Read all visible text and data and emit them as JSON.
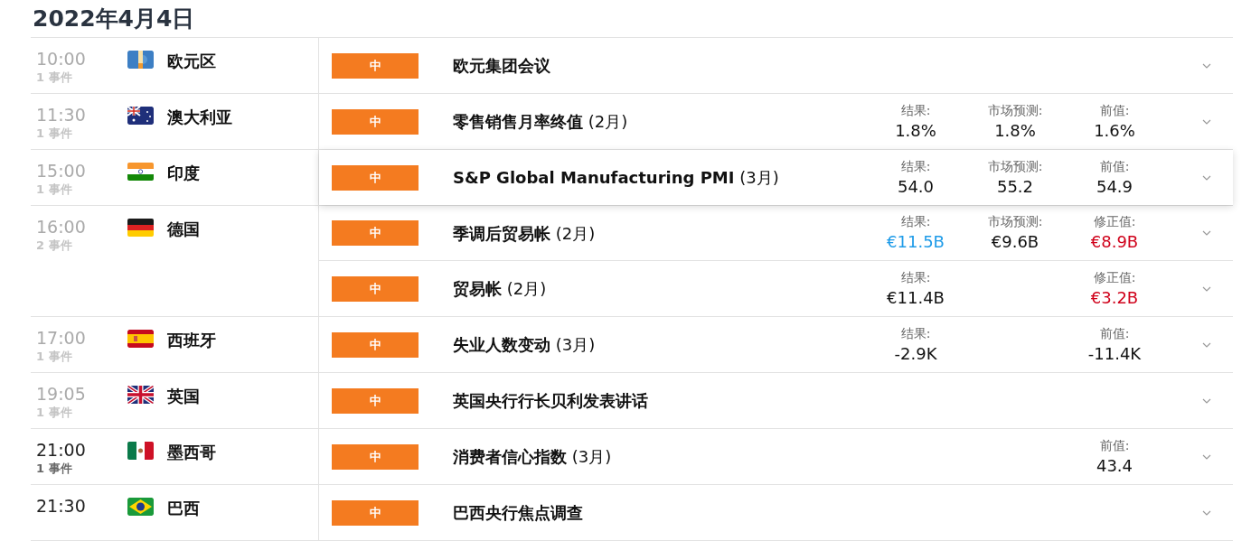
{
  "date_heading": "2022年4月4日",
  "groups": [
    {
      "time": "10:00",
      "count": "1 事件",
      "past": true,
      "kind": "eu",
      "country": "欧元区",
      "events": [
        {
          "impact": "中",
          "title": "欧元集团会议",
          "highlighted": false
        }
      ]
    },
    {
      "time": "11:30",
      "count": "1 事件",
      "past": true,
      "kind": "au",
      "country": "澳大利亚",
      "events": [
        {
          "impact": "中",
          "title": "零售销售月率终值",
          "period": "(2月)",
          "highlighted": false,
          "actual": {
            "label": "结果:",
            "value": "1.8%"
          },
          "forecast": {
            "label": "市场预测:",
            "value": "1.8%"
          },
          "previous": {
            "label": "前值:",
            "value": "1.6%"
          }
        }
      ]
    },
    {
      "time": "15:00",
      "count": "1 事件",
      "past": true,
      "kind": "in",
      "country": "印度",
      "events": [
        {
          "impact": "中",
          "title": "S&P Global Manufacturing PMI",
          "period": "(3月)",
          "highlighted": true,
          "actual": {
            "label": "结果:",
            "value": "54.0"
          },
          "forecast": {
            "label": "市场预测:",
            "value": "55.2"
          },
          "previous": {
            "label": "前值:",
            "value": "54.9"
          }
        }
      ]
    },
    {
      "time": "16:00",
      "count": "2 事件",
      "past": true,
      "kind": "de",
      "country": "德国",
      "events": [
        {
          "impact": "中",
          "title": "季调后贸易帐",
          "period": "(2月)",
          "highlighted": false,
          "actual": {
            "label": "结果:",
            "value": "€11.5B",
            "color": "#1e9be8"
          },
          "forecast": {
            "label": "市场预测:",
            "value": "€9.6B"
          },
          "previous": {
            "label": "修正值:",
            "value": "€8.9B",
            "color": "#d0021b"
          }
        },
        {
          "impact": "中",
          "title": "贸易帐",
          "period": "(2月)",
          "highlighted": false,
          "actual": {
            "label": "结果:",
            "value": "€11.4B"
          },
          "previous": {
            "label": "修正值:",
            "value": "€3.2B",
            "color": "#d0021b"
          }
        }
      ]
    },
    {
      "time": "17:00",
      "count": "1 事件",
      "past": true,
      "kind": "es",
      "country": "西班牙",
      "events": [
        {
          "impact": "中",
          "title": "失业人数变动",
          "period": "(3月)",
          "highlighted": false,
          "actual": {
            "label": "结果:",
            "value": "-2.9K"
          },
          "previous": {
            "label": "前值:",
            "value": "-11.4K"
          }
        }
      ]
    },
    {
      "time": "19:05",
      "count": "1 事件",
      "past": true,
      "kind": "gb",
      "country": "英国",
      "events": [
        {
          "impact": "中",
          "title": "英国央行行长贝利发表讲话",
          "highlighted": false
        }
      ]
    },
    {
      "time": "21:00",
      "count": "1 事件",
      "past": false,
      "kind": "mx",
      "country": "墨西哥",
      "events": [
        {
          "impact": "中",
          "title": "消费者信心指数",
          "period": "(3月)",
          "highlighted": false,
          "previous": {
            "label": "前值:",
            "value": "43.4"
          }
        }
      ]
    },
    {
      "time": "21:30",
      "past": false,
      "kind": "br",
      "country": "巴西",
      "events": [
        {
          "impact": "中",
          "title": "巴西央行焦点调查",
          "highlighted": false
        }
      ]
    }
  ]
}
